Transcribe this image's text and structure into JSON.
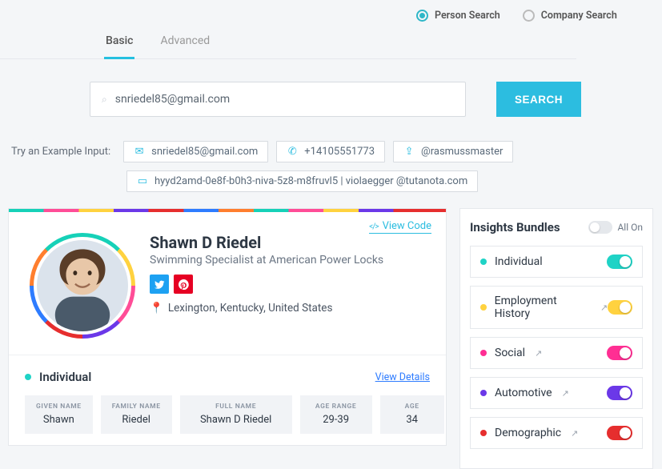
{
  "search_type": {
    "person": "Person Search",
    "company": "Company Search",
    "selected": "person"
  },
  "tabs": {
    "basic": "Basic",
    "advanced": "Advanced",
    "active": "basic"
  },
  "search": {
    "value": "snriedel85@gmail.com",
    "button": "SEARCH"
  },
  "examples": {
    "label": "Try an Example Input:",
    "items": [
      {
        "icon": "mail",
        "text": "snriedel85@gmail.com"
      },
      {
        "icon": "phone",
        "text": "+14105551773"
      },
      {
        "icon": "share",
        "text": "@rasmussmaster"
      },
      {
        "icon": "id",
        "text": "hyyd2amd-0e8f-b0h3-niva-5z8-m8fruvl5 | violaegger @tutanota.com"
      }
    ]
  },
  "result": {
    "viewcode": "View Code",
    "name": "Shawn D Riedel",
    "subtitle": "Swimming Specialist at American Power Locks",
    "location": "Lexington, Kentucky, United States",
    "section": {
      "title": "Individual",
      "color": "#1fd3c6",
      "view": "View Details",
      "fields": [
        {
          "label": "GIVEN NAME",
          "value": "Shawn",
          "w": "f-sm"
        },
        {
          "label": "FAMILY NAME",
          "value": "Riedel",
          "w": "f-sm"
        },
        {
          "label": "FULL NAME",
          "value": "Shawn D Riedel",
          "w": "f-lg"
        },
        {
          "label": "AGE RANGE",
          "value": "29-39",
          "w": "f-md"
        },
        {
          "label": "AGE",
          "value": "34",
          "w": "f-sm"
        }
      ]
    }
  },
  "bundles": {
    "title": "Insights Bundles",
    "allon": "All On",
    "items": [
      {
        "name": "Individual",
        "color": "#1fd3c6",
        "ext": false
      },
      {
        "name": "Employment History",
        "color": "#ffd23f",
        "ext": true
      },
      {
        "name": "Social",
        "color": "#ff2e93",
        "ext": true
      },
      {
        "name": "Automotive",
        "color": "#6b38e8",
        "ext": true
      },
      {
        "name": "Demographic",
        "color": "#e62e2e",
        "ext": true
      }
    ]
  }
}
